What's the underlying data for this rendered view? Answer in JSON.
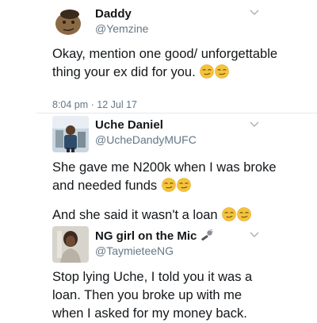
{
  "tweets": [
    {
      "name": "Daddy",
      "handle": "@Yemzine",
      "text": "Okay, mention one good/ unforgettable thing your ex did for you.",
      "timestamp": "8:04 pm · 12 Jul 17",
      "emojis": [
        "smirk-emoji",
        "smirk-emoji"
      ]
    },
    {
      "name": "Uche Daniel",
      "handle": "@UcheDandyMUFC",
      "text": "She gave me N200k when I was broke and needed funds",
      "text2": "And she said it wasn't a loan",
      "emojis": [
        "smirk-emoji",
        "smirk-emoji"
      ]
    },
    {
      "name": "NG girl on the Mic",
      "handle": "@TaymieteeNG",
      "name_icon": "microphone-emoji",
      "text": "Stop lying Uche, I told you it was a loan. Then you broke up with me when I asked for my money back."
    }
  ],
  "colors": {
    "text": "#14171a",
    "secondary": "#657786",
    "divider": "#e1e8ed",
    "emoji": "#f5c33b"
  }
}
